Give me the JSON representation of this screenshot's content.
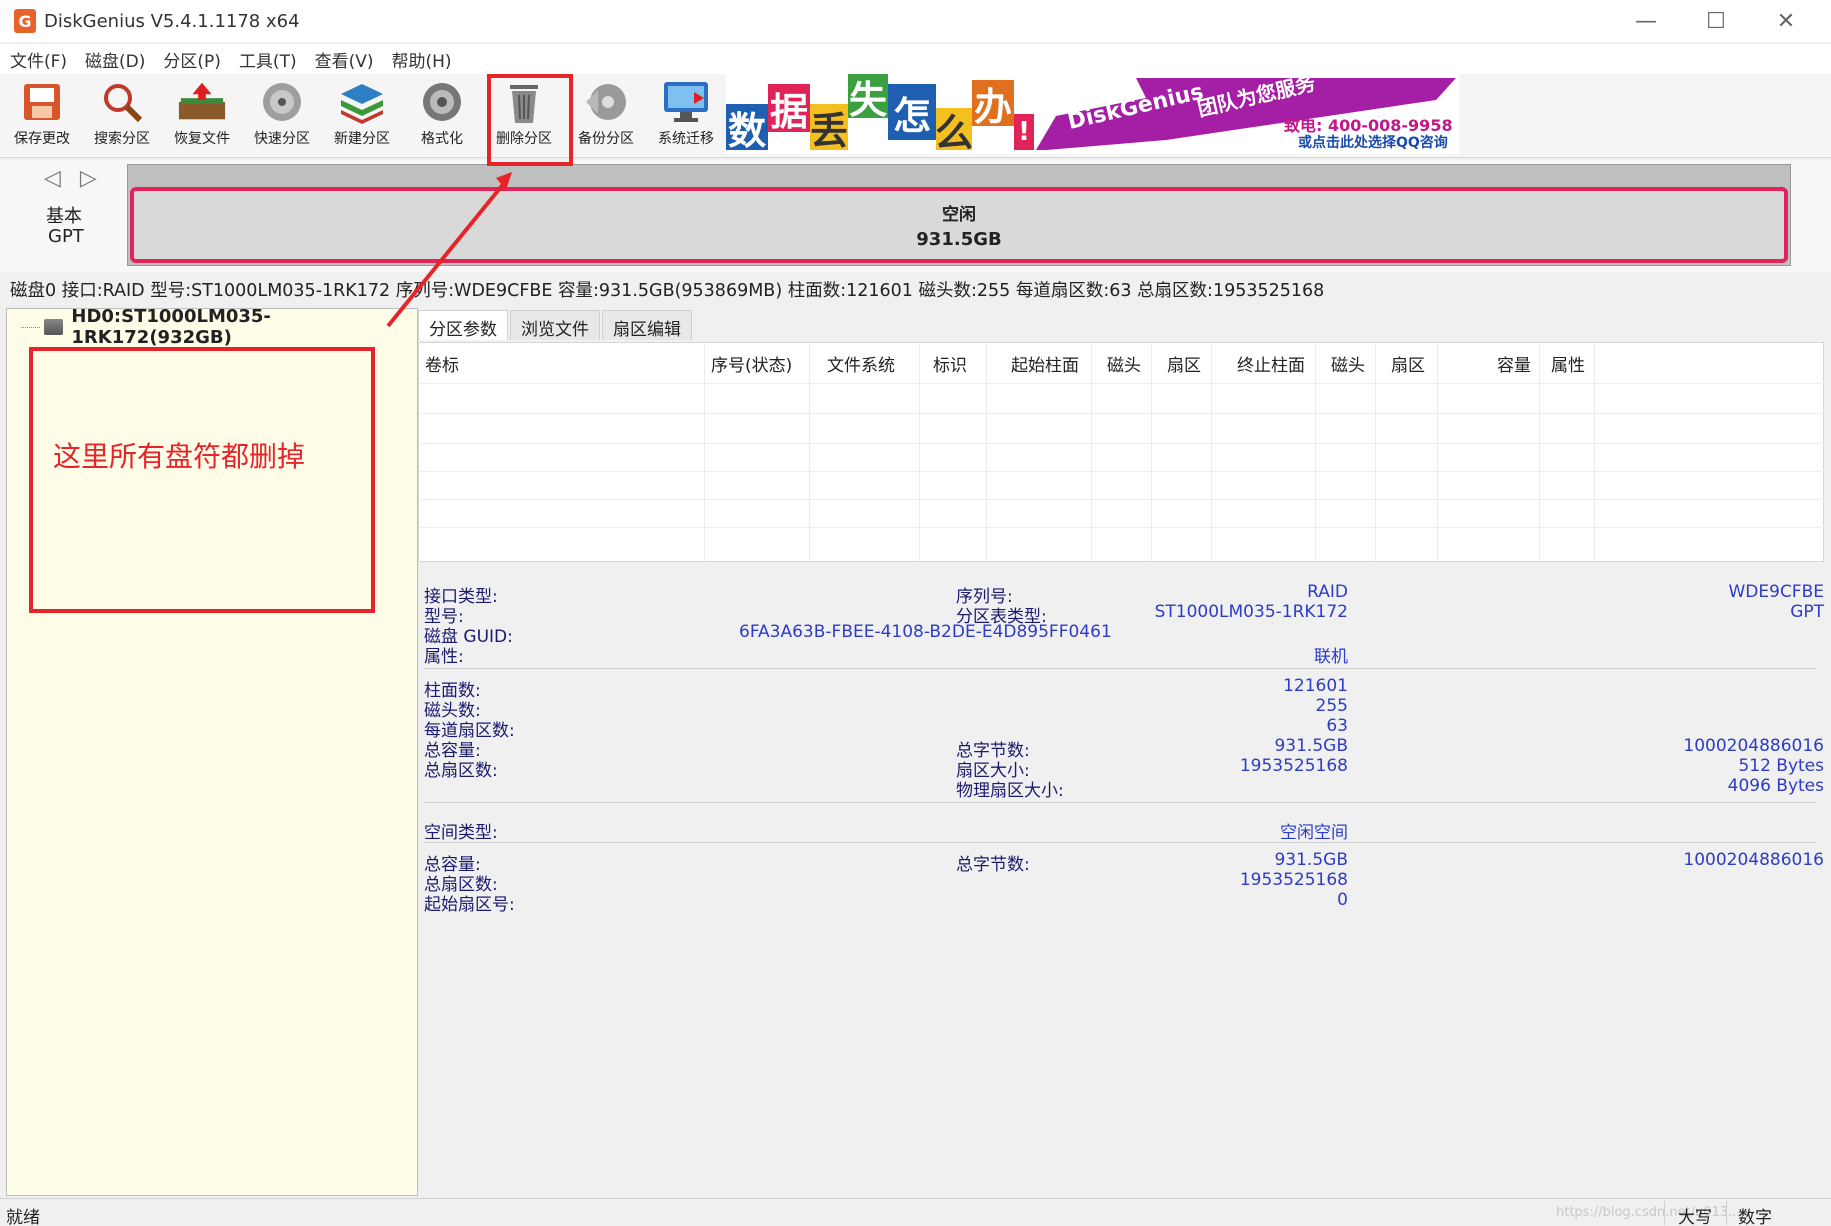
{
  "window": {
    "title": "DiskGenius V5.4.1.1178 x64",
    "logo_letter": "G",
    "minimize": "—",
    "maximize": "☐",
    "close": "✕"
  },
  "menu": [
    "文件(F)",
    "磁盘(D)",
    "分区(P)",
    "工具(T)",
    "查看(V)",
    "帮助(H)"
  ],
  "toolbar": [
    {
      "label": "保存更改",
      "icon": "save-icon"
    },
    {
      "label": "搜索分区",
      "icon": "search-icon"
    },
    {
      "label": "恢复文件",
      "icon": "recover-icon"
    },
    {
      "label": "快速分区",
      "icon": "quick-partition-icon"
    },
    {
      "label": "新建分区",
      "icon": "new-partition-icon"
    },
    {
      "label": "格式化",
      "icon": "format-icon"
    },
    {
      "label": "删除分区",
      "icon": "delete-partition-icon"
    },
    {
      "label": "备份分区",
      "icon": "backup-icon"
    },
    {
      "label": "系统迁移",
      "icon": "migrate-icon"
    }
  ],
  "banner": {
    "tiles": [
      "数",
      "据",
      "丢",
      "失",
      "怎",
      "么",
      "办",
      "!"
    ],
    "brand": "DiskGenius",
    "team": "团队为您服务",
    "phone": "致电: 400-008-9958",
    "qq": "或点击此处选择QQ咨询"
  },
  "diskbar": {
    "arrows": "◁ ▷",
    "type1": "基本",
    "type2": "GPT",
    "partition_name": "空闲",
    "partition_size": "931.5GB"
  },
  "info_strip": "磁盘0 接口:RAID  型号:ST1000LM035-1RK172  序列号:WDE9CFBE  容量:931.5GB(953869MB)  柱面数:121601  磁头数:255  每道扇区数:63  总扇区数:1953525168",
  "tree": {
    "disk_label": "HD0:ST1000LM035-1RK172(932GB)"
  },
  "annotation": {
    "text": "这里所有盘符都删掉"
  },
  "tabs": [
    "分区参数",
    "浏览文件",
    "扇区编辑"
  ],
  "grid_headers": [
    "卷标",
    "序号(状态)",
    "文件系统",
    "标识",
    "起始柱面",
    "磁头",
    "扇区",
    "终止柱面",
    "磁头",
    "扇区",
    "容量",
    "属性"
  ],
  "props": {
    "interface_label": "接口类型:",
    "interface_value": "RAID",
    "serial_label": "序列号:",
    "serial_value": "WDE9CFBE",
    "model_label": "型号:",
    "model_value": "ST1000LM035-1RK172",
    "pt_label": "分区表类型:",
    "pt_value": "GPT",
    "guid_label": "磁盘 GUID:",
    "guid_value": "6FA3A63B-FBEE-4108-B2DE-E4D895FF0461",
    "attr_label": "属性:",
    "attr_value": "联机",
    "cyl_label": "柱面数:",
    "cyl_value": "121601",
    "heads_label": "磁头数:",
    "heads_value": "255",
    "spt_label": "每道扇区数:",
    "spt_value": "63",
    "cap_label": "总容量:",
    "cap_value": "931.5GB",
    "bytes_label": "总字节数:",
    "bytes_value": "1000204886016",
    "sectors_label": "总扇区数:",
    "sectors_value": "1953525168",
    "secsize_label": "扇区大小:",
    "secsize_value": "512 Bytes",
    "physsec_label": "物理扇区大小:",
    "physsec_value": "4096 Bytes",
    "space_label": "空间类型:",
    "space_value": "空闲空间",
    "cap2_label": "总容量:",
    "cap2_value": "931.5GB",
    "bytes2_label": "总字节数:",
    "bytes2_value": "1000204886016",
    "sectors2_label": "总扇区数:",
    "sectors2_value": "1953525168",
    "start_label": "起始扇区号:",
    "start_value": "0"
  },
  "status": {
    "text": "就绪",
    "caps": "大写",
    "num": "数字",
    "watermark": "https://blog.csdn.net/u013..."
  },
  "colors": {
    "annotation_red": "#e5252a",
    "partition_border": "#e0245a",
    "value_blue": "#2c3cc8",
    "tree_bg": "#fffde7"
  }
}
